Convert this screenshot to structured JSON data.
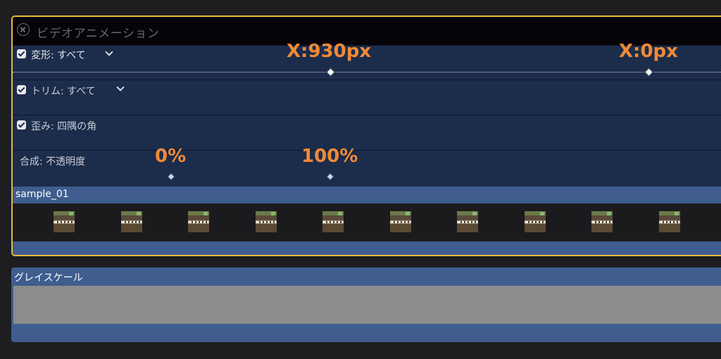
{
  "animation_editor": {
    "title": "ビデオアニメーション",
    "close_icon": "close-circle-icon"
  },
  "params": [
    {
      "label": "変形: すべて",
      "checked": true,
      "dropdown": true
    },
    {
      "label": "トリム: すべて",
      "checked": true,
      "dropdown": true
    },
    {
      "label": "歪み: 四隅の角",
      "checked": true,
      "dropdown": false
    },
    {
      "label": "合成: 不透明度",
      "checked": false,
      "dropdown": false
    }
  ],
  "annotations": {
    "transform_start": "X:930px",
    "transform_end": "X:0px",
    "opacity_start": "0%",
    "opacity_end": "100%"
  },
  "clip": {
    "name": "sample_01",
    "thumbnail_count": 10
  },
  "gray_clip": {
    "name": "グレイスケール"
  },
  "colors": {
    "selection": "#e6b840",
    "annotation": "#f08a38",
    "clip": "#3f5d8e"
  }
}
